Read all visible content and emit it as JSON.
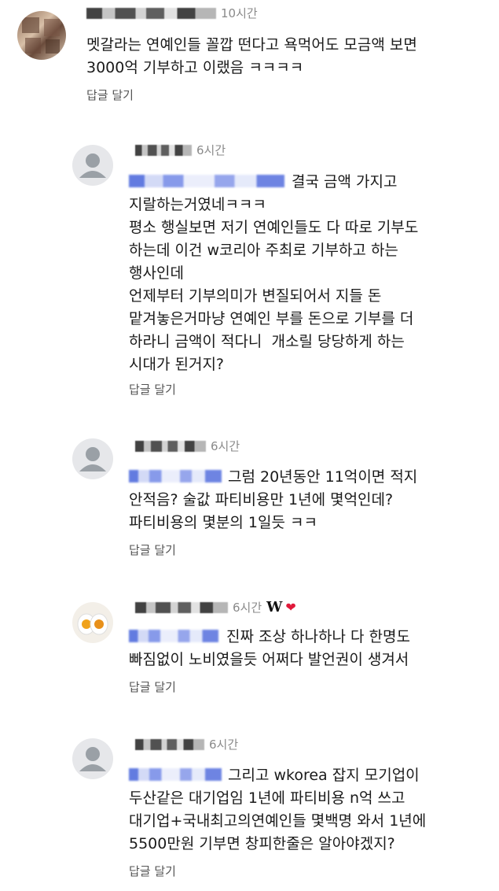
{
  "comments": [
    {
      "time": "10시간",
      "text": "멧갈라는 연예인들 꼴깝 떤다고 욕먹어도 모금액 보면\n3000억 기부하고 이랬음 ㅋㅋㅋㅋ",
      "reply": "답글 달기"
    },
    {
      "time": "6시간",
      "text": "결국 금액 가지고\n지랄하는거였네ㅋㅋㅋ\n평소 행실보면 저기 연예인들도 다 따로 기부도\n하는데 이건 w코리아 주최로 기부하고 하는\n행사인데\n언제부터 기부의미가 변질되어서 지들 돈\n맡겨놓은거마냥 연예인 부를 돈으로 기부를 더\n하라니 금액이 적다니  개소릴 당당하게 하는\n시대가 된거지?",
      "reply": "답글 달기"
    },
    {
      "time": "6시간",
      "text": "그럼 20년동안 11억이면 적지\n안적음? 술값 파티비용만 1년에 몇억인데?\n파티비용의 몇분의 1일듯 ㅋㅋ",
      "reply": "답글 달기"
    },
    {
      "time": "6시간",
      "badge": "W",
      "text": "진짜 조상 하나하나 다 한명도\n빠짐없이 노비였을듯 어쩌다 발언권이 생겨서",
      "reply": "답글 달기"
    },
    {
      "time": "6시간",
      "text": "그리고 wkorea 잡지 모기업이\n두산같은 대기업임 1년에 파티비용 n억 쓰고\n대기업+국내최고의연예인들 몇백명 와서 1년에\n5500만원 기부면 창피한줄은 알아야겠지?",
      "reply": "답글 달기"
    }
  ],
  "icons": {
    "avatar_default": "person-icon",
    "heart": "heart-icon"
  },
  "colors": {
    "heart": "#e0193a",
    "time": "#8a8a8a",
    "mention": "#3b5bd9"
  }
}
